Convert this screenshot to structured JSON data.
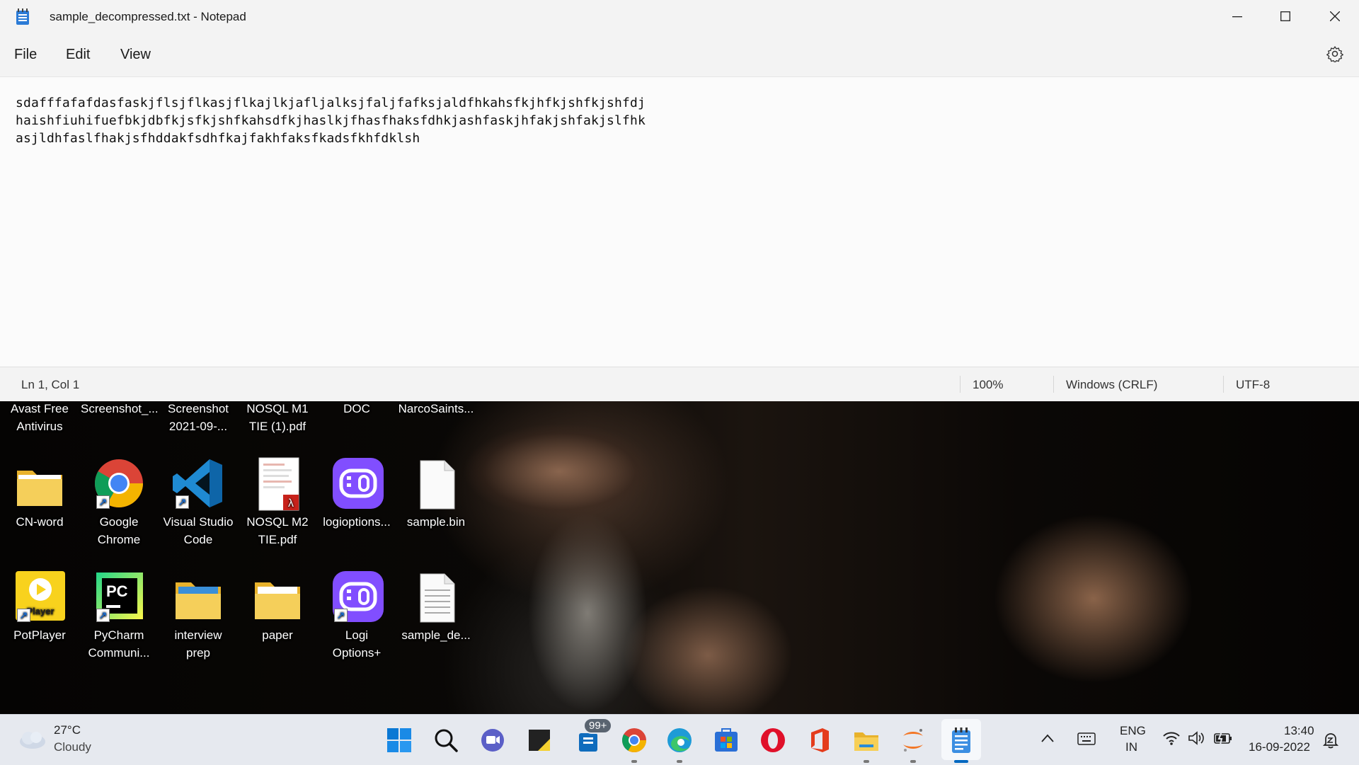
{
  "window": {
    "title": "sample_decompressed.txt - Notepad",
    "menu": [
      "File",
      "Edit",
      "View"
    ],
    "content_lines": [
      "sdafffafafdasfaskjflsjflkasjflkajlkjafljalksjfaljfafksjaldfhkahsfkjhfkjshfkjshfdj",
      "haishfiuhifuefbkjdbfkjsfkjshfkahsdfkjhaslkjfhasfhaksfdhkjashfaskjhfakjshfakjslfhk",
      "asjldhfaslfhakjsfhddakfsdhfkajfakhfaksfkadsfkhfdklsh"
    ],
    "status": {
      "position": "Ln 1, Col 1",
      "zoom": "100%",
      "line_ending": "Windows (CRLF)",
      "encoding": "UTF-8"
    }
  },
  "desktop": {
    "top_row": [
      {
        "line1": "Avast Free",
        "line2": "Antivirus"
      },
      {
        "line1": "Screenshot_...",
        "line2": ""
      },
      {
        "line1": "Screenshot",
        "line2": "2021-09-..."
      },
      {
        "line1": "NOSQL M1",
        "line2": "TIE (1).pdf"
      },
      {
        "line1": "DOC",
        "line2": ""
      },
      {
        "line1": "NarcoSaints...",
        "line2": ""
      }
    ],
    "row2": [
      {
        "line1": "CN-word",
        "line2": "",
        "icon": "folder-icon"
      },
      {
        "line1": "Google",
        "line2": "Chrome",
        "icon": "chrome-icon"
      },
      {
        "line1": "Visual Studio",
        "line2": "Code",
        "icon": "vscode-icon"
      },
      {
        "line1": "NOSQL M2",
        "line2": "TIE.pdf",
        "icon": "pdf-icon"
      },
      {
        "line1": "logioptions...",
        "line2": "",
        "icon": "logi-icon"
      },
      {
        "line1": "sample.bin",
        "line2": "",
        "icon": "file-icon"
      }
    ],
    "row3": [
      {
        "line1": "PotPlayer",
        "line2": "",
        "icon": "potplayer-icon"
      },
      {
        "line1": "PyCharm",
        "line2": "Communi...",
        "icon": "pycharm-icon"
      },
      {
        "line1": "interview",
        "line2": "prep",
        "icon": "folder-icon"
      },
      {
        "line1": "paper",
        "line2": "",
        "icon": "folder-icon"
      },
      {
        "line1": "Logi",
        "line2": "Options+",
        "icon": "logi-icon"
      },
      {
        "line1": "sample_de...",
        "line2": "",
        "icon": "text-file-icon"
      }
    ],
    "potplayer_badge": "Player",
    "pycharm_badge": "PC"
  },
  "taskbar": {
    "weather_temp": "27°C",
    "weather_desc": "Cloudy",
    "mail_badge": "99+",
    "lang_line1": "ENG",
    "lang_line2": "IN",
    "time": "13:40",
    "date": "16-09-2022"
  },
  "colors": {
    "accent_blue": "#0067c0",
    "notepad_blue": "#2b7bd6",
    "logi_purple": "#814eff",
    "folder_yellow": "#f5c843"
  }
}
